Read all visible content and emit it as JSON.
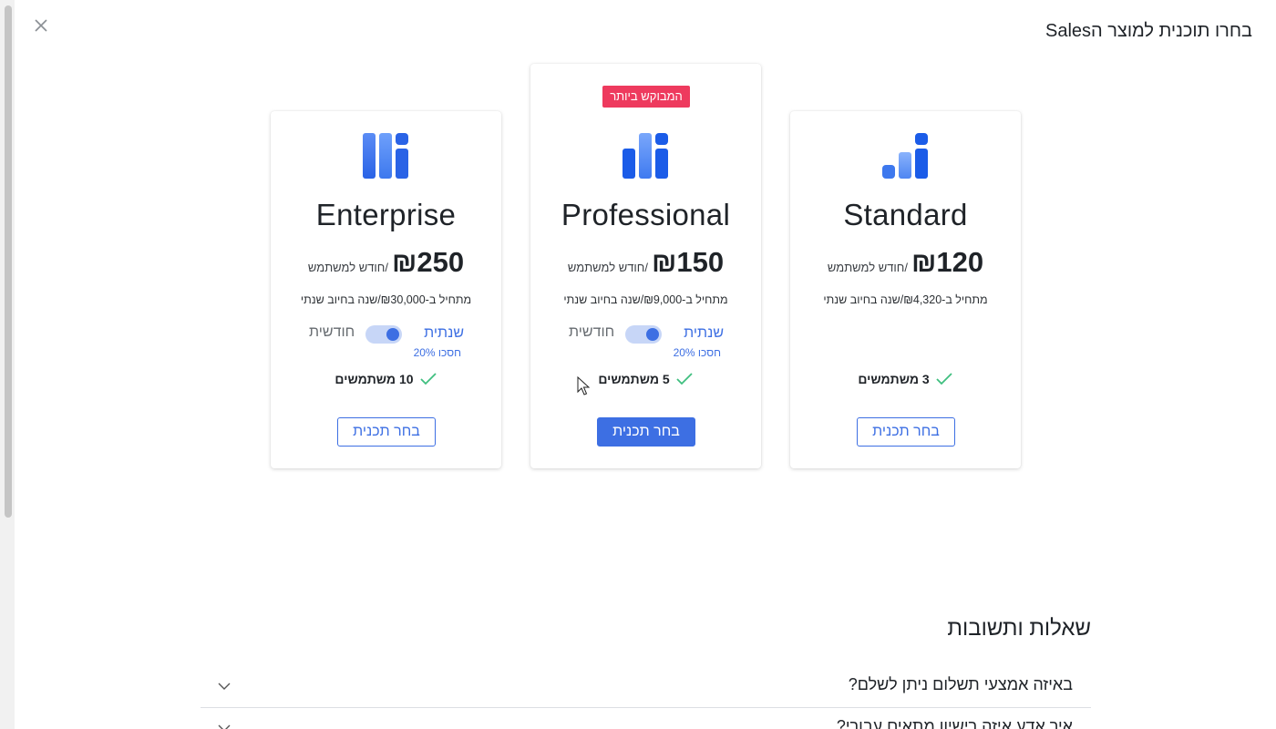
{
  "header": {
    "title": "בחרו תוכנית למוצר הSales"
  },
  "icons": {
    "close": "close-icon",
    "check": "check-icon",
    "chevron": "chevron-down-icon"
  },
  "colors": {
    "accent": "#3d6fe3",
    "badge": "#ee3a5e",
    "check": "#3fbf7f"
  },
  "plans": {
    "enterprise": {
      "name": "Enterprise",
      "price": "₪250",
      "price_unit": "/חודש למשתמש",
      "annual": "מתחיל ב-₪30,000/שנה בחיוב שנתי",
      "toggle": {
        "monthly": "חודשית",
        "yearly": "שנתית",
        "save": "חסכו 20%",
        "selected": "yearly"
      },
      "users": "10 משתמשים",
      "button": "בחר תכנית"
    },
    "professional": {
      "badge": "המבוקש ביותר",
      "name": "Professional",
      "price": "₪150",
      "price_unit": "/חודש למשתמש",
      "annual": "מתחיל ב-₪9,000/שנה בחיוב שנתי",
      "toggle": {
        "monthly": "חודשית",
        "yearly": "שנתית",
        "save": "חסכו 20%",
        "selected": "yearly"
      },
      "users": "5 משתמשים",
      "button": "בחר תכנית"
    },
    "standard": {
      "name": "Standard",
      "price": "₪120",
      "price_unit": "/חודש למשתמש",
      "annual": "מתחיל ב-₪4,320/שנה בחיוב שנתי",
      "users": "3 משתמשים",
      "button": "בחר תכנית"
    }
  },
  "faq": {
    "title": "שאלות ותשובות",
    "items": [
      {
        "question": "באיזה אמצעי תשלום ניתן לשלם?"
      },
      {
        "question": "איך אדע איזה רישיון מתאים עבורי?"
      }
    ]
  }
}
